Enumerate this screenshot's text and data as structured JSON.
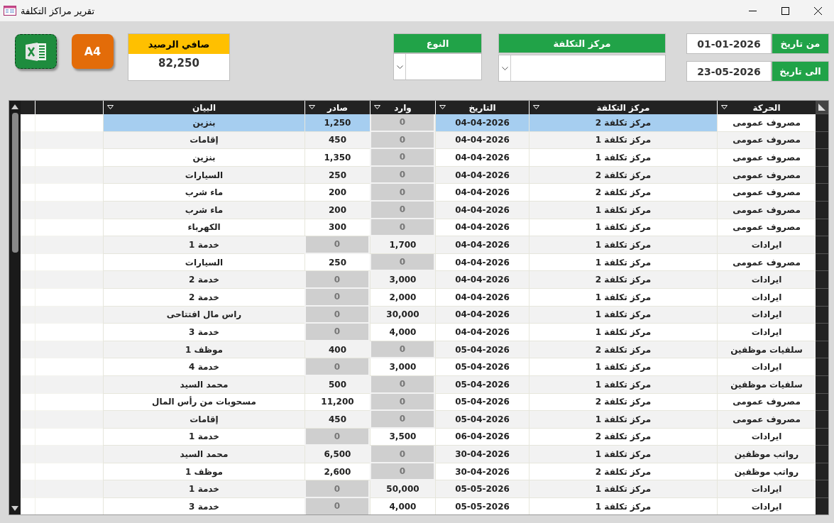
{
  "window": {
    "title": "تقرير مراكز التكلفة"
  },
  "toolbar": {
    "print_button": {
      "label": "A4"
    },
    "balance": {
      "label": "صافي الرصيد",
      "value": "82,250"
    }
  },
  "filters": {
    "type": {
      "label": "النوع"
    },
    "cost_center": {
      "label": "مركز التكلفة"
    },
    "date_from": {
      "label": "من تاريخ",
      "value": "01-01-2026"
    },
    "date_to": {
      "label": "الى تاريخ",
      "value": "23-05-2026"
    }
  },
  "table": {
    "columns": [
      "الحركة",
      "مركز التكلفة",
      "التاريخ",
      "وارد",
      "صادر",
      "البيان"
    ],
    "rows": [
      {
        "movement": "مصروف عمومى",
        "cost_center": "مركز تكلفة 2",
        "date": "04-04-2026",
        "in": "0",
        "out": "1,250",
        "description": "بنزين",
        "kind": "expense",
        "selected": true
      },
      {
        "movement": "مصروف عمومى",
        "cost_center": "مركز تكلفة 1",
        "date": "04-04-2026",
        "in": "0",
        "out": "450",
        "description": "إقامات",
        "kind": "expense",
        "selected": false
      },
      {
        "movement": "مصروف عمومى",
        "cost_center": "مركز تكلفة 1",
        "date": "04-04-2026",
        "in": "0",
        "out": "1,350",
        "description": "بنزين",
        "kind": "expense",
        "selected": false
      },
      {
        "movement": "مصروف عمومى",
        "cost_center": "مركز تكلفة 2",
        "date": "04-04-2026",
        "in": "0",
        "out": "250",
        "description": "السيارات",
        "kind": "expense",
        "selected": false
      },
      {
        "movement": "مصروف عمومى",
        "cost_center": "مركز تكلفة 2",
        "date": "04-04-2026",
        "in": "0",
        "out": "200",
        "description": "ماء شرب",
        "kind": "expense",
        "selected": false
      },
      {
        "movement": "مصروف عمومى",
        "cost_center": "مركز تكلفة 1",
        "date": "04-04-2026",
        "in": "0",
        "out": "200",
        "description": "ماء شرب",
        "kind": "expense",
        "selected": false
      },
      {
        "movement": "مصروف عمومى",
        "cost_center": "مركز تكلفة 1",
        "date": "04-04-2026",
        "in": "0",
        "out": "300",
        "description": "الكهرباء",
        "kind": "expense",
        "selected": false
      },
      {
        "movement": "ايرادات",
        "cost_center": "مركز تكلفة 1",
        "date": "04-04-2026",
        "in": "1,700",
        "out": "0",
        "description": "خدمة 1",
        "kind": "income",
        "selected": false
      },
      {
        "movement": "مصروف عمومى",
        "cost_center": "مركز تكلفة 1",
        "date": "04-04-2026",
        "in": "0",
        "out": "250",
        "description": "السيارات",
        "kind": "expense",
        "selected": false
      },
      {
        "movement": "ايرادات",
        "cost_center": "مركز تكلفة 2",
        "date": "04-04-2026",
        "in": "3,000",
        "out": "0",
        "description": "خدمة 2",
        "kind": "income",
        "selected": false
      },
      {
        "movement": "ايرادات",
        "cost_center": "مركز تكلفة 1",
        "date": "04-04-2026",
        "in": "2,000",
        "out": "0",
        "description": "خدمة 2",
        "kind": "income",
        "selected": false
      },
      {
        "movement": "ايرادات",
        "cost_center": "مركز تكلفة 1",
        "date": "04-04-2026",
        "in": "30,000",
        "out": "0",
        "description": "راس مال افتتاحى",
        "kind": "income",
        "selected": false
      },
      {
        "movement": "ايرادات",
        "cost_center": "مركز تكلفة 1",
        "date": "04-04-2026",
        "in": "4,000",
        "out": "0",
        "description": "خدمة 3",
        "kind": "income",
        "selected": false
      },
      {
        "movement": "سلفيات موظفين",
        "cost_center": "مركز تكلفة 2",
        "date": "05-04-2026",
        "in": "0",
        "out": "400",
        "description": "موظف 1",
        "kind": "expense",
        "selected": false
      },
      {
        "movement": "ايرادات",
        "cost_center": "مركز تكلفة 1",
        "date": "05-04-2026",
        "in": "3,000",
        "out": "0",
        "description": "خدمة 4",
        "kind": "income",
        "selected": false
      },
      {
        "movement": "سلفيات موظفين",
        "cost_center": "مركز تكلفة 1",
        "date": "05-04-2026",
        "in": "0",
        "out": "500",
        "description": "محمد السيد",
        "kind": "expense",
        "selected": false
      },
      {
        "movement": "مصروف عمومى",
        "cost_center": "مركز تكلفة 2",
        "date": "05-04-2026",
        "in": "0",
        "out": "11,200",
        "description": "مسحوبات من رأس المال",
        "kind": "expense",
        "selected": false
      },
      {
        "movement": "مصروف عمومى",
        "cost_center": "مركز تكلفة 1",
        "date": "05-04-2026",
        "in": "0",
        "out": "450",
        "description": "إقامات",
        "kind": "expense",
        "selected": false
      },
      {
        "movement": "ايرادات",
        "cost_center": "مركز تكلفة 2",
        "date": "06-04-2026",
        "in": "3,500",
        "out": "0",
        "description": "خدمة 1",
        "kind": "income",
        "selected": false
      },
      {
        "movement": "رواتب موظفين",
        "cost_center": "مركز تكلفة 1",
        "date": "30-04-2026",
        "in": "0",
        "out": "6,500",
        "description": "محمد السيد",
        "kind": "expense",
        "selected": false
      },
      {
        "movement": "رواتب موظفين",
        "cost_center": "مركز تكلفة 2",
        "date": "30-04-2026",
        "in": "0",
        "out": "2,600",
        "description": "موظف 1",
        "kind": "expense",
        "selected": false
      },
      {
        "movement": "ايرادات",
        "cost_center": "مركز تكلفة 1",
        "date": "05-05-2026",
        "in": "50,000",
        "out": "0",
        "description": "خدمة 1",
        "kind": "income",
        "selected": false
      },
      {
        "movement": "ايرادات",
        "cost_center": "مركز تكلفة 1",
        "date": "05-05-2026",
        "in": "4,000",
        "out": "0",
        "description": "خدمة 3",
        "kind": "income",
        "selected": false
      }
    ]
  }
}
